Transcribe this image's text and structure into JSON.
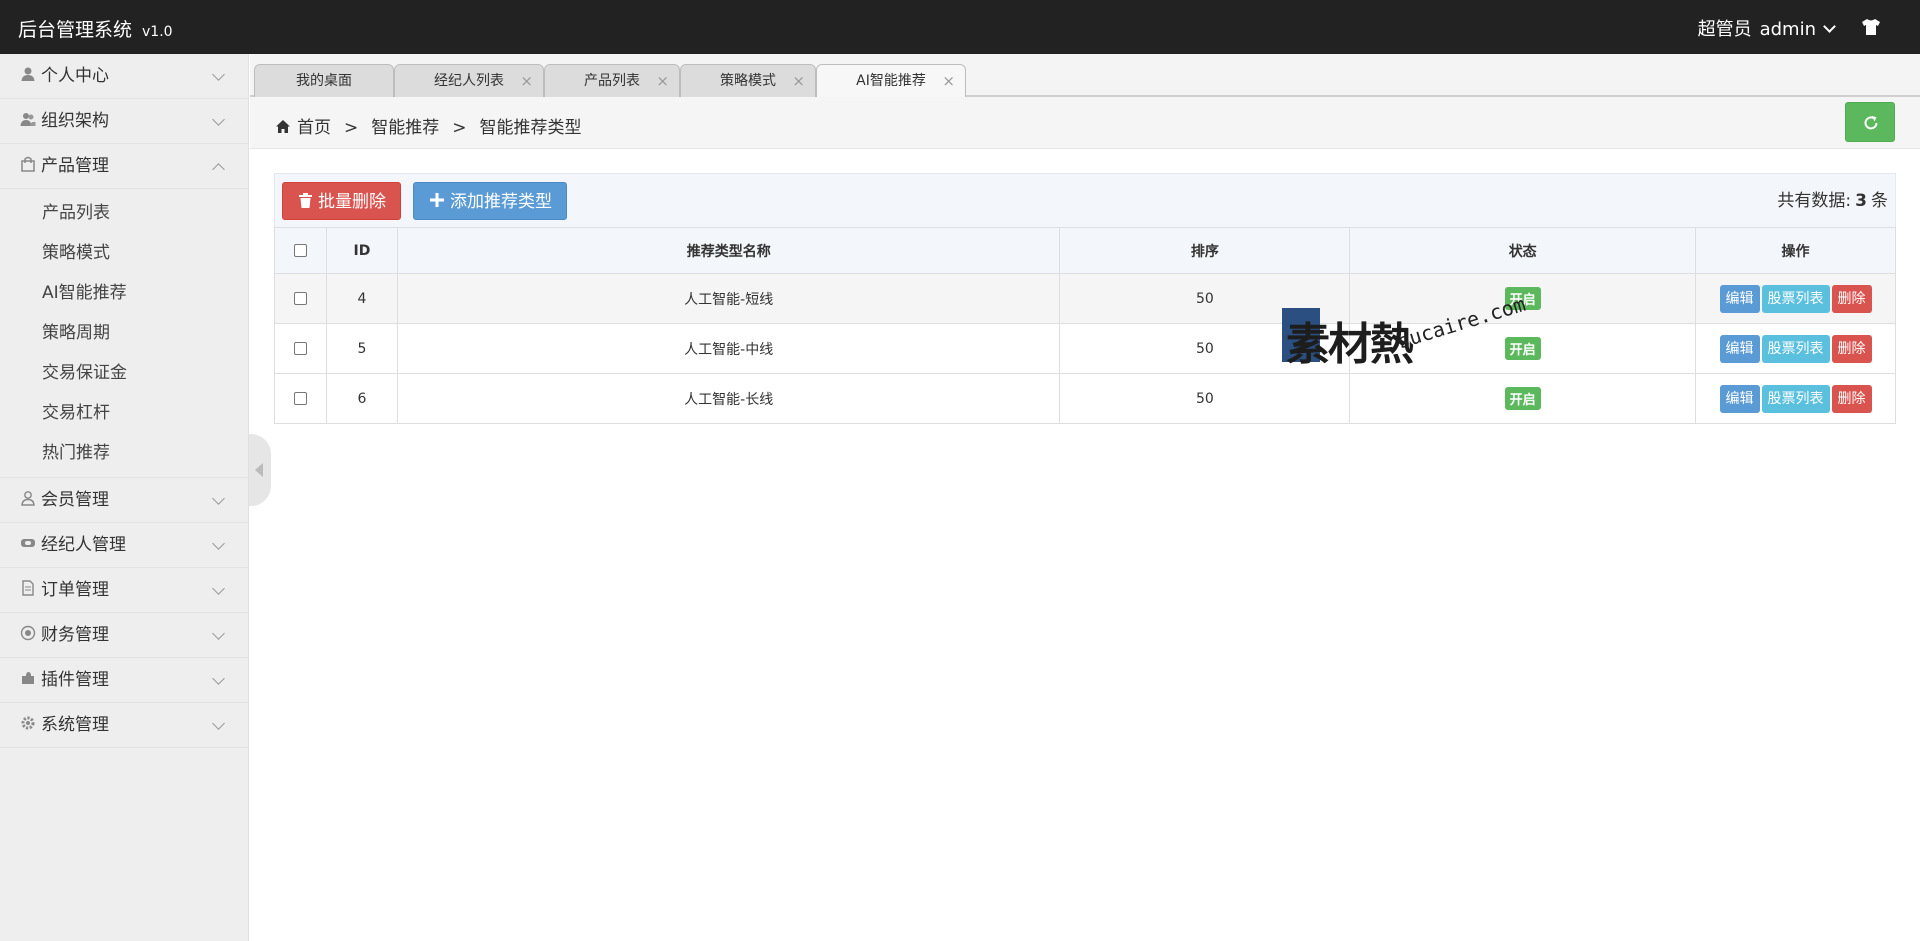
{
  "header": {
    "app_title": "后台管理系统",
    "version": "v1.0",
    "role": "超管员",
    "username": "admin"
  },
  "sidebar": {
    "items": [
      {
        "label": "个人中心",
        "icon": "user-icon"
      },
      {
        "label": "组织架构",
        "icon": "users-icon"
      },
      {
        "label": "产品管理",
        "icon": "shopping-bag-icon",
        "expanded": true,
        "children": [
          "产品列表",
          "策略模式",
          "AI智能推荐",
          "策略周期",
          "交易保证金",
          "交易杠杆",
          "热门推荐"
        ]
      },
      {
        "label": "会员管理",
        "icon": "member-icon"
      },
      {
        "label": "经纪人管理",
        "icon": "handshake-icon"
      },
      {
        "label": "订单管理",
        "icon": "document-icon"
      },
      {
        "label": "财务管理",
        "icon": "finance-icon"
      },
      {
        "label": "插件管理",
        "icon": "puzzle-icon"
      },
      {
        "label": "系统管理",
        "icon": "gear-icon"
      }
    ]
  },
  "tabs": [
    {
      "label": "我的桌面",
      "closable": false
    },
    {
      "label": "经纪人列表",
      "closable": true
    },
    {
      "label": "产品列表",
      "closable": true
    },
    {
      "label": "策略模式",
      "closable": true
    },
    {
      "label": "AI智能推荐",
      "closable": true,
      "active": true
    }
  ],
  "breadcrumb": {
    "home": "首页",
    "sep": ">",
    "level1": "智能推荐",
    "level2": "智能推荐类型"
  },
  "toolbar": {
    "batch_delete": "批量删除",
    "add_type": "添加推荐类型",
    "total_prefix": "共有数据:",
    "total_count": "3",
    "total_suffix": "条"
  },
  "table": {
    "headers": [
      "ID",
      "推荐类型名称",
      "排序",
      "状态",
      "操作"
    ],
    "rows": [
      {
        "id": "4",
        "name": "人工智能-短线",
        "sort": "50",
        "status": "开启"
      },
      {
        "id": "5",
        "name": "人工智能-中线",
        "sort": "50",
        "status": "开启"
      },
      {
        "id": "6",
        "name": "人工智能-长线",
        "sort": "50",
        "status": "开启"
      }
    ],
    "actions": {
      "edit": "编辑",
      "stocks": "股票列表",
      "delete": "删除"
    }
  },
  "watermark": {
    "cn": "素材熱",
    "en": "sucaire.com"
  },
  "colors": {
    "header_bg": "#222222",
    "success": "#5cb85c",
    "danger": "#d9534f",
    "primary": "#5b9bd5",
    "info": "#5bc0de"
  }
}
